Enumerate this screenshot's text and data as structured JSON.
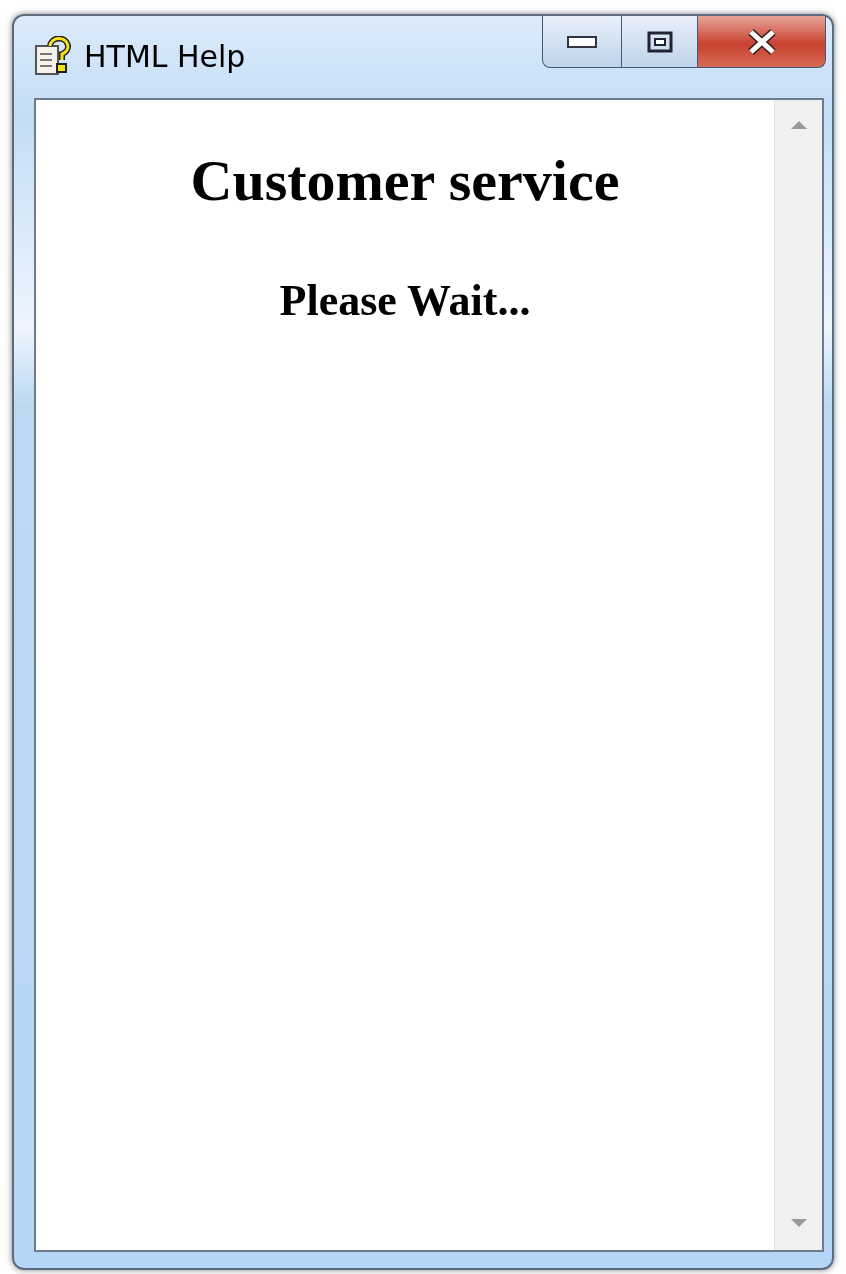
{
  "window": {
    "title": "HTML Help"
  },
  "content": {
    "heading": "Customer service",
    "message": "Please Wait..."
  }
}
